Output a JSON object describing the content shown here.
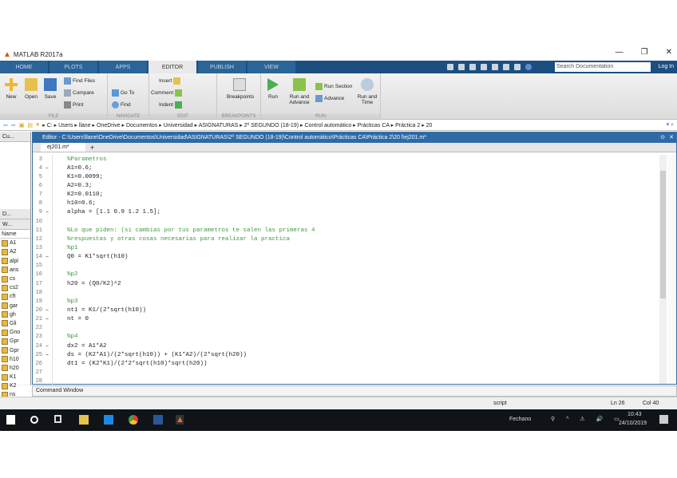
{
  "window": {
    "title": "MATLAB R2017a",
    "minimize": "—",
    "restore": "❐",
    "close": "✕"
  },
  "tabs": [
    "HOME",
    "PLOTS",
    "APPS",
    "EDITOR",
    "PUBLISH",
    "VIEW"
  ],
  "active_tab": "EDITOR",
  "search": {
    "placeholder": "Search Documentation"
  },
  "login": "Log In",
  "toolstrip": {
    "file": {
      "label": "FILE",
      "new": "New",
      "open": "Open",
      "save": "Save",
      "find_files": "Find Files",
      "compare": "Compare",
      "print": "Print"
    },
    "navigate": {
      "label": "NAVIGATE",
      "goto": "Go To",
      "find": "Find"
    },
    "edit": {
      "label": "EDIT",
      "insert": "Insert",
      "comment": "Comment",
      "indent": "Indent"
    },
    "breakpoints": {
      "label": "BREAKPOINTS",
      "breakpoints": "Breakpoints"
    },
    "run": {
      "label": "RUN",
      "run": "Run",
      "run_advance": "Run and Advance",
      "run_section": "Run Section",
      "advance": "Advance",
      "run_time": "Run and Time"
    }
  },
  "address": [
    "C:",
    "Users",
    "llane",
    "OneDrive",
    "Documentos",
    "Universidad",
    "ASIGNATURAS",
    "2º SEGUNDO (18-19)",
    "Control automático",
    "Prácticas CA",
    "Práctica 2",
    "20"
  ],
  "current_folder_label": "Cu...",
  "details_label": "D...",
  "workspace": {
    "label": "W...",
    "name_header": "Name",
    "vars": [
      "A1",
      "A2",
      "alpl",
      "ans",
      "cs",
      "cs2",
      "cft",
      "gar",
      "gh",
      "Gli",
      "Gno",
      "Gpr",
      "Gpr",
      "h10",
      "h20",
      "K1",
      "K2",
      "ns"
    ]
  },
  "editor": {
    "title": "Editor - C:\\Users\\llane\\OneDrive\\Documentos\\Universidad\\ASIGNATURAS\\2º SEGUNDO (18-19)\\Control automático\\Prácticas CA\\Práctica 2\\20 l\\ej201.m*",
    "tab": "ej201.m*",
    "add_tab": "+",
    "lines": [
      {
        "n": "3",
        "b": "",
        "t": "%Parametros",
        "c": true
      },
      {
        "n": "4",
        "b": "–",
        "t": "A1=0.6;",
        "c": false
      },
      {
        "n": "5",
        "b": "",
        "t": "K1=0.0099;",
        "c": false
      },
      {
        "n": "6",
        "b": "",
        "t": "A2=0.3;",
        "c": false
      },
      {
        "n": "7",
        "b": "",
        "t": "K2=0.0110;",
        "c": false
      },
      {
        "n": "8",
        "b": "",
        "t": "h10=0.6;",
        "c": false
      },
      {
        "n": "9",
        "b": "–",
        "t": "alpha = [1.1 0.9 1.2 1.5];",
        "c": false
      },
      {
        "n": "10",
        "b": "",
        "t": "",
        "c": false
      },
      {
        "n": "11",
        "b": "",
        "t": "%Lo que piden: (si cambias por tus parametros te salen las primeras 4",
        "c": true
      },
      {
        "n": "12",
        "b": "",
        "t": "%respuestas y otras cosas necesarias para realizar la practica",
        "c": true
      },
      {
        "n": "13",
        "b": "",
        "t": "%p1",
        "c": true
      },
      {
        "n": "14",
        "b": "–",
        "t": "Q0 = K1*sqrt(h10)",
        "c": false
      },
      {
        "n": "15",
        "b": "",
        "t": "",
        "c": false
      },
      {
        "n": "16",
        "b": "",
        "t": "%p2",
        "c": true
      },
      {
        "n": "17",
        "b": "",
        "t": "h20 = (Q0/K2)^2",
        "c": false
      },
      {
        "n": "18",
        "b": "",
        "t": "",
        "c": false
      },
      {
        "n": "19",
        "b": "",
        "t": "%p3",
        "c": true
      },
      {
        "n": "20",
        "b": "–",
        "t": "nt1 = K1/(2*sqrt(h10))",
        "c": false
      },
      {
        "n": "21",
        "b": "–",
        "t": "nt = 0",
        "c": false
      },
      {
        "n": "22",
        "b": "",
        "t": "",
        "c": false
      },
      {
        "n": "23",
        "b": "",
        "t": "%p4",
        "c": true
      },
      {
        "n": "24",
        "b": "–",
        "t": "dx2 = A1*A2",
        "c": false
      },
      {
        "n": "25",
        "b": "–",
        "t": "ds = (K2*A1)/(2*sqrt(h10)) + (K1*A2)/(2*sqrt(h20))",
        "c": false
      },
      {
        "n": "26",
        "b": "",
        "t": "dt1 = (K2*K1)/(2*2*sqrt(h10)*sqrt(h20))",
        "c": false
      },
      {
        "n": "27",
        "b": "",
        "t": "",
        "c": false
      },
      {
        "n": "28",
        "b": "",
        "t": "",
        "c": false
      }
    ]
  },
  "command_window": "Command Window",
  "status": {
    "mode": "script",
    "ln": "Ln 26",
    "col": "Col 40"
  },
  "taskbar": {
    "language": "Fechano",
    "time": "10:43",
    "date": "24/10/2019"
  }
}
